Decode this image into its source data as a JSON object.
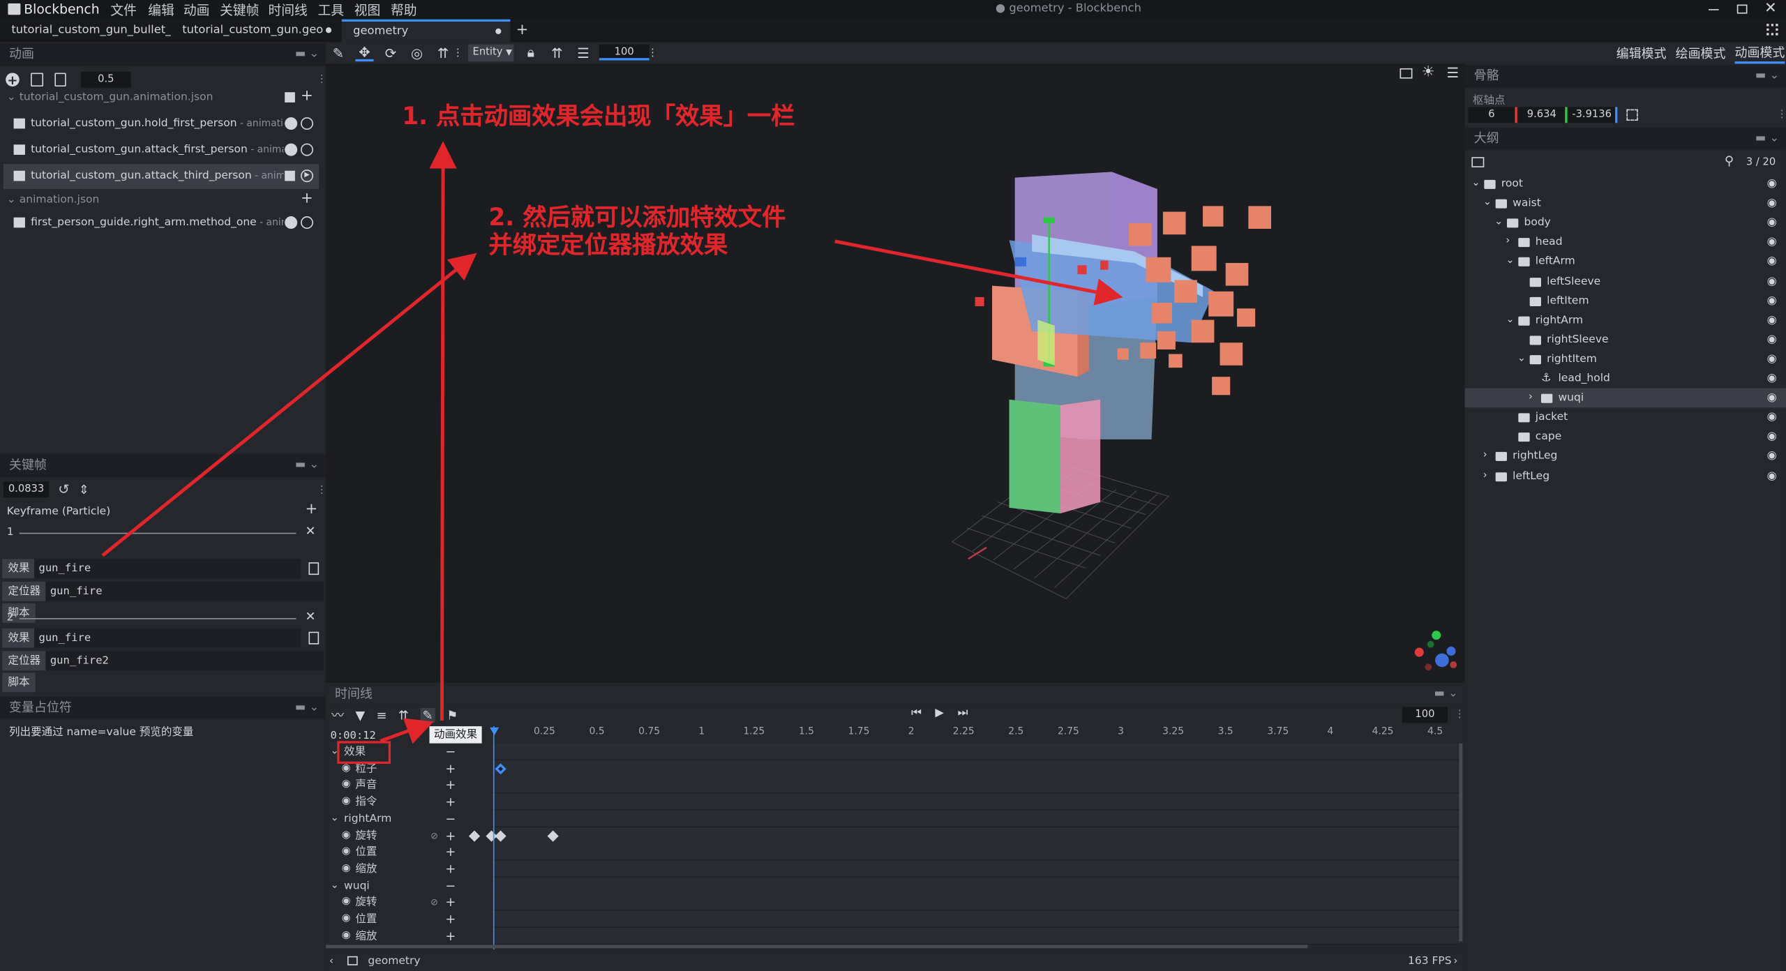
{
  "app": {
    "name": "Blockbench",
    "window_title": "● geometry - Blockbench"
  },
  "menu": [
    "文件",
    "编辑",
    "动画",
    "关键帧",
    "时间线",
    "工具",
    "视图",
    "帮助"
  ],
  "file_tabs": [
    "tutorial_custom_gun_bullet_proje",
    "tutorial_custom_gun.geo",
    "geometry"
  ],
  "toolbar": {
    "mode_select": "Entity",
    "zoom_value": "100",
    "modes": [
      "编辑模式",
      "绘画模式",
      "动画模式"
    ]
  },
  "animations_panel": {
    "title": "动画",
    "speed_value": "0.5",
    "files": [
      {
        "name": "tutorial_custom_gun.animation.json",
        "items": [
          {
            "name": "tutorial_custom_gun.hold_first_person",
            "file": " - animation.tuto"
          },
          {
            "name": "tutorial_custom_gun.attack_first_person",
            "file": " - animation.tu"
          },
          {
            "name": "tutorial_custom_gun.attack_third_person",
            "file": " - animation.t"
          }
        ]
      },
      {
        "name": "animation.json",
        "items": [
          {
            "name": "first_person_guide.right_arm.method_one",
            "file": " - animation."
          }
        ]
      }
    ]
  },
  "keyframe_panel": {
    "title": "关键帧",
    "time_value": "0.0833",
    "type_label": "Keyframe (Particle)",
    "entries": [
      {
        "index": "1",
        "effect_label": "效果",
        "effect_value": "gun_fire",
        "locator_label": "定位器",
        "locator_value": "gun_fire",
        "script_label": "脚本"
      },
      {
        "index": "2",
        "effect_label": "效果",
        "effect_value": "gun_fire",
        "locator_label": "定位器",
        "locator_value": "gun_fire2",
        "script_label": "脚本"
      }
    ]
  },
  "variable_panel": {
    "title": "变量占位符",
    "text": "列出要通过 name=value 预览的变量"
  },
  "bone_panel": {
    "title": "骨骼",
    "pivot_label": "枢轴点",
    "pivot": [
      "6",
      "9.634",
      "-3.9136"
    ]
  },
  "outliner": {
    "title": "大纲",
    "count": "3 / 20",
    "items": [
      {
        "name": "root",
        "depth": 0,
        "arrow": "down"
      },
      {
        "name": "waist",
        "depth": 1,
        "arrow": "down"
      },
      {
        "name": "body",
        "depth": 2,
        "arrow": "down"
      },
      {
        "name": "head",
        "depth": 3,
        "arrow": "right"
      },
      {
        "name": "leftArm",
        "depth": 3,
        "arrow": "down"
      },
      {
        "name": "leftSleeve",
        "depth": 4,
        "arrow": ""
      },
      {
        "name": "leftItem",
        "depth": 4,
        "arrow": ""
      },
      {
        "name": "rightArm",
        "depth": 3,
        "arrow": "down"
      },
      {
        "name": "rightSleeve",
        "depth": 4,
        "arrow": ""
      },
      {
        "name": "rightItem",
        "depth": 4,
        "arrow": "down"
      },
      {
        "name": "lead_hold",
        "depth": 5,
        "arrow": "",
        "locator": true
      },
      {
        "name": "wuqi",
        "depth": 5,
        "arrow": "right",
        "selected": true
      },
      {
        "name": "jacket",
        "depth": 3,
        "arrow": ""
      },
      {
        "name": "cape",
        "depth": 3,
        "arrow": ""
      },
      {
        "name": "rightLeg",
        "depth": 1,
        "arrow": "right"
      },
      {
        "name": "leftLeg",
        "depth": 1,
        "arrow": "right"
      }
    ]
  },
  "timeline": {
    "title": "时间线",
    "time": "0:00:12",
    "zoom": "100",
    "tooltip": "动画效果",
    "ticks": [
      "0.25",
      "0.5",
      "0.75",
      "1",
      "1.25",
      "1.5",
      "1.75",
      "2",
      "2.25",
      "2.5",
      "2.75",
      "3",
      "3.25",
      "3.5",
      "3.75",
      "4",
      "4.25",
      "4.5"
    ],
    "rows": [
      {
        "name": "效果",
        "kind": "group"
      },
      {
        "name": "粒子",
        "kind": "channel"
      },
      {
        "name": "声音",
        "kind": "channel"
      },
      {
        "name": "指令",
        "kind": "channel"
      },
      {
        "name": "rightArm",
        "kind": "group"
      },
      {
        "name": "旋转",
        "kind": "channel"
      },
      {
        "name": "位置",
        "kind": "channel"
      },
      {
        "name": "缩放",
        "kind": "channel"
      },
      {
        "name": "wuqi",
        "kind": "group"
      },
      {
        "name": "旋转",
        "kind": "channel"
      },
      {
        "name": "位置",
        "kind": "channel"
      },
      {
        "name": "缩放",
        "kind": "channel"
      }
    ],
    "keyframes": {
      "particle": [
        0.0833
      ],
      "rightArm_rotation": [
        -0.0833,
        0,
        0.0417,
        0.2917
      ]
    }
  },
  "status": {
    "tab": "geometry",
    "fps": "163 FPS"
  },
  "annotations": {
    "note1": "1. 点击动画效果会出现「效果」一栏",
    "note2_line1": "2. 然后就可以添加特效文件",
    "note2_line2": "并绑定定位器播放效果"
  },
  "colors": {
    "accent": "#3e90ff",
    "annotation": "#e0262a",
    "selected_row": "#3b3e47"
  }
}
